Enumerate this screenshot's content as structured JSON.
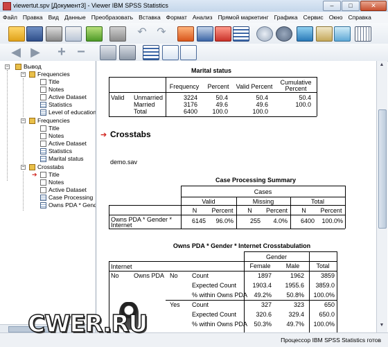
{
  "window": {
    "title": "viewertut.spv [Документ3] - Viewer IBM SPSS Statistics",
    "min_label": "–",
    "max_label": "□",
    "close_label": "✕"
  },
  "menu": [
    "Файл",
    "Правка",
    "Вид",
    "Данные",
    "Преобразовать",
    "Вставка",
    "Формат",
    "Анализ",
    "Прямой маркетинг",
    "Графика",
    "Сервис",
    "Окно",
    "Справка"
  ],
  "outline": {
    "root": "Вывод",
    "items": [
      {
        "label": "Frequencies",
        "type": "book",
        "level": 1
      },
      {
        "label": "Title",
        "type": "page",
        "level": 2
      },
      {
        "label": "Notes",
        "type": "page",
        "level": 2
      },
      {
        "label": "Active Dataset",
        "type": "page",
        "level": 2
      },
      {
        "label": "Statistics",
        "type": "tbl",
        "level": 2
      },
      {
        "label": "Level of education",
        "type": "tbl",
        "level": 2
      },
      {
        "label": "Frequencies",
        "type": "book",
        "level": 1
      },
      {
        "label": "Title",
        "type": "page",
        "level": 2
      },
      {
        "label": "Notes",
        "type": "page",
        "level": 2
      },
      {
        "label": "Active Dataset",
        "type": "page",
        "level": 2
      },
      {
        "label": "Statistics",
        "type": "tbl",
        "level": 2
      },
      {
        "label": "Marital status",
        "type": "tbl",
        "level": 2
      },
      {
        "label": "Crosstabs",
        "type": "book",
        "level": 1
      },
      {
        "label": "Title",
        "type": "page",
        "level": 2,
        "current": true
      },
      {
        "label": "Notes",
        "type": "page",
        "level": 2
      },
      {
        "label": "Active Dataset",
        "type": "page",
        "level": 2
      },
      {
        "label": "Case Processing",
        "type": "tbl",
        "level": 2
      },
      {
        "label": "Owns PDA * Gend",
        "type": "tbl",
        "level": 2
      }
    ]
  },
  "marital": {
    "title": "Marital status",
    "headers": [
      "Frequency",
      "Percent",
      "Valid Percent",
      "Cumulative Percent"
    ],
    "cum_header_1": "Cumulative",
    "cum_header_2": "Percent",
    "valid": "Valid",
    "rows": [
      {
        "label": "Unmarried",
        "freq": "3224",
        "pct": "50.4",
        "vpct": "50.4",
        "cum": "50.4"
      },
      {
        "label": "Married",
        "freq": "3176",
        "pct": "49.6",
        "vpct": "49.6",
        "cum": "100.0"
      },
      {
        "label": "Total",
        "freq": "6400",
        "pct": "100.0",
        "vpct": "100.0",
        "cum": ""
      }
    ]
  },
  "crosstabs_heading": "Crosstabs",
  "dataset_name": "demo.sav",
  "case_summary": {
    "title": "Case Processing Summary",
    "cases": "Cases",
    "groups": [
      "Valid",
      "Missing",
      "Total"
    ],
    "sub": [
      "N",
      "Percent",
      "N",
      "Percent",
      "N",
      "Percent"
    ],
    "row_label_1": "Owns PDA * Gender *",
    "row_label_2": "Internet",
    "values": [
      "6145",
      "96.0%",
      "255",
      "4.0%",
      "6400",
      "100.0%"
    ]
  },
  "crosstab": {
    "title": "Owns PDA * Gender * Internet Crosstabulation",
    "gender": "Gender",
    "internet": "Internet",
    "cols": [
      "Female",
      "Male",
      "Total"
    ],
    "no": "No",
    "owns_pda": "Owns PDA",
    "rows": [
      {
        "pda": "No",
        "stat": "Count",
        "f": "1897",
        "m": "1962",
        "t": "3859"
      },
      {
        "pda": "",
        "stat": "Expected Count",
        "f": "1903.4",
        "m": "1955.6",
        "t": "3859.0"
      },
      {
        "pda": "",
        "stat": "% within Owns PDA",
        "f": "49.2%",
        "m": "50.8%",
        "t": "100.0%"
      },
      {
        "pda": "Yes",
        "stat": "Count",
        "f": "327",
        "m": "323",
        "t": "650"
      },
      {
        "pda": "",
        "stat": "Expected Count",
        "f": "320.6",
        "m": "329.4",
        "t": "650.0"
      },
      {
        "pda": "",
        "stat": "% within Owns PDA",
        "f": "50.3%",
        "m": "49.7%",
        "t": "100.0%"
      }
    ]
  },
  "status": "Процессор IBM SPSS Statistics  готов",
  "watermark": "CWER.RU"
}
